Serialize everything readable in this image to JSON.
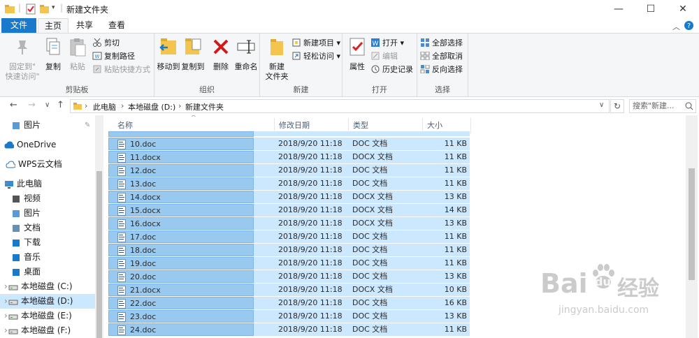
{
  "window": {
    "title": "新建文件夹",
    "minimize": "—",
    "maximize": "☐",
    "close": "✕"
  },
  "ribbon_tabs": {
    "file": "文件",
    "home": "主页",
    "share": "共享",
    "view": "查看"
  },
  "ribbon": {
    "clipboard": {
      "label": "剪贴板",
      "pin": "固定到\"快速访问\"",
      "pin_line1": "固定到\"",
      "pin_line2": "快速访问\"",
      "copy": "复制",
      "paste": "粘贴",
      "cut": "剪切",
      "copy_path": "复制路径",
      "paste_shortcut": "粘贴快捷方式"
    },
    "organize": {
      "label": "组织",
      "move_to": "移动到",
      "copy_to": "复制到",
      "delete": "删除",
      "rename": "重命名"
    },
    "new": {
      "label": "新建",
      "new_folder_line1": "新建",
      "new_folder_line2": "文件夹",
      "new_item": "新建项目",
      "easy_access": "轻松访问"
    },
    "open": {
      "label": "打开",
      "properties": "属性",
      "open": "打开",
      "edit": "编辑",
      "history": "历史记录"
    },
    "select": {
      "label": "选择",
      "select_all": "全部选择",
      "select_none": "全部取消",
      "invert": "反向选择"
    }
  },
  "address": {
    "crumbs": [
      "此电脑",
      "本地磁盘 (D:)",
      "新建文件夹"
    ],
    "search_placeholder": "搜索\"新建..."
  },
  "nav": {
    "items": [
      {
        "label": "图片",
        "icon": "pictures-icon",
        "pinned": true
      },
      {
        "label": "OneDrive",
        "icon": "onedrive-icon"
      },
      {
        "label": "WPS云文档",
        "icon": "wps-cloud-icon"
      },
      {
        "label": "此电脑",
        "icon": "this-pc-icon"
      },
      {
        "label": "视频",
        "icon": "videos-icon"
      },
      {
        "label": "图片",
        "icon": "pictures-icon"
      },
      {
        "label": "文档",
        "icon": "documents-icon"
      },
      {
        "label": "下载",
        "icon": "downloads-icon"
      },
      {
        "label": "音乐",
        "icon": "music-icon"
      },
      {
        "label": "桌面",
        "icon": "desktop-icon"
      },
      {
        "label": "本地磁盘 (C:)",
        "icon": "drive-icon"
      },
      {
        "label": "本地磁盘 (D:)",
        "icon": "drive-icon",
        "selected": true
      },
      {
        "label": "本地磁盘 (E:)",
        "icon": "drive-icon"
      },
      {
        "label": "本地磁盘 (F:)",
        "icon": "drive-icon"
      }
    ]
  },
  "columns": {
    "name": "名称",
    "date": "修改日期",
    "type": "类型",
    "size": "大小"
  },
  "files": [
    {
      "name": "10.doc",
      "date": "2018/9/20 11:18",
      "type": "DOC 文档",
      "size": "11 KB"
    },
    {
      "name": "11.docx",
      "date": "2018/9/20 11:18",
      "type": "DOCX 文档",
      "size": "11 KB"
    },
    {
      "name": "12.doc",
      "date": "2018/9/20 11:18",
      "type": "DOC 文档",
      "size": "11 KB"
    },
    {
      "name": "13.doc",
      "date": "2018/9/20 11:18",
      "type": "DOC 文档",
      "size": "11 KB"
    },
    {
      "name": "14.docx",
      "date": "2018/9/20 11:18",
      "type": "DOCX 文档",
      "size": "13 KB"
    },
    {
      "name": "15.docx",
      "date": "2018/9/20 11:18",
      "type": "DOCX 文档",
      "size": "14 KB"
    },
    {
      "name": "16.docx",
      "date": "2018/9/20 11:18",
      "type": "DOCX 文档",
      "size": "13 KB"
    },
    {
      "name": "17.doc",
      "date": "2018/9/20 11:18",
      "type": "DOC 文档",
      "size": "11 KB"
    },
    {
      "name": "18.doc",
      "date": "2018/9/20 11:18",
      "type": "DOC 文档",
      "size": "11 KB"
    },
    {
      "name": "19.doc",
      "date": "2018/9/20 11:18",
      "type": "DOC 文档",
      "size": "11 KB"
    },
    {
      "name": "20.doc",
      "date": "2018/9/20 11:18",
      "type": "DOC 文档",
      "size": "13 KB"
    },
    {
      "name": "21.docx",
      "date": "2018/9/20 11:18",
      "type": "DOCX 文档",
      "size": "10 KB"
    },
    {
      "name": "22.doc",
      "date": "2018/9/20 11:18",
      "type": "DOC 文档",
      "size": "16 KB"
    },
    {
      "name": "23.doc",
      "date": "2018/9/20 11:18",
      "type": "DOC 文档",
      "size": "13 KB"
    },
    {
      "name": "24.doc",
      "date": "2018/9/20 11:18",
      "type": "DOC 文档",
      "size": "11 KB"
    }
  ],
  "watermark": {
    "brand": "Bai",
    "brand2": "du",
    "cn": "经验",
    "url": "jingyan.baidu.com"
  },
  "colors": {
    "accent": "#1979ca",
    "selection": "#cce8ff",
    "selection_focus": "#99c9ef"
  }
}
